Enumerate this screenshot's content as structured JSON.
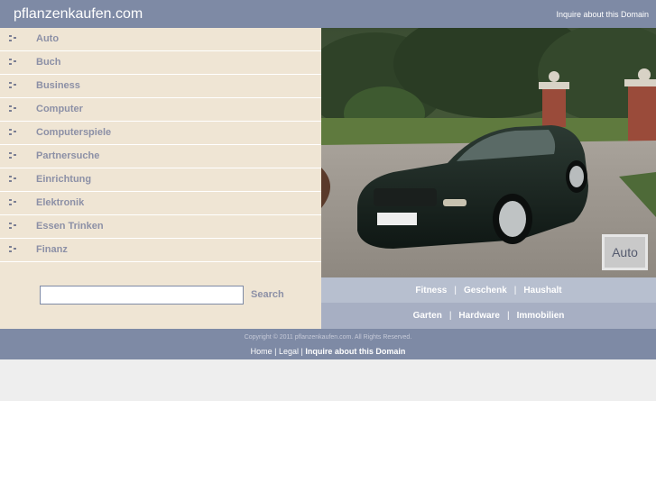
{
  "header": {
    "site_title": "pflanzenkaufen.com",
    "inquire_label": "Inquire about this Domain"
  },
  "sidebar": {
    "items": [
      {
        "label": "Auto"
      },
      {
        "label": "Buch"
      },
      {
        "label": "Business"
      },
      {
        "label": "Computer"
      },
      {
        "label": "Computerspiele"
      },
      {
        "label": "Partnersuche"
      },
      {
        "label": "Einrichtung"
      },
      {
        "label": "Elektronik"
      },
      {
        "label": "Essen Trinken"
      },
      {
        "label": "Finanz"
      }
    ]
  },
  "search": {
    "value": "",
    "button_label": "Search"
  },
  "photo": {
    "badge_label": "Auto"
  },
  "links": {
    "row1": [
      "Fitness",
      "Geschenk",
      "Haushalt"
    ],
    "row2": [
      "Garten",
      "Hardware",
      "Immobilien"
    ],
    "separator": "|"
  },
  "footer": {
    "copyright": "Copyright © 2011 pflanzenkaufen.com. All Rights Reserved.",
    "home_label": "Home",
    "legal_label": "Legal",
    "inquire_label": "Inquire about this Domain",
    "separator": "|"
  },
  "colors": {
    "header_bg": "#7e8aa5",
    "sidebar_bg": "#efe5d4",
    "nav_text": "#8c90a6",
    "links_row1_bg": "#b7bfcf",
    "links_row2_bg": "#a7afc3",
    "grey_band": "#eeeeee"
  }
}
